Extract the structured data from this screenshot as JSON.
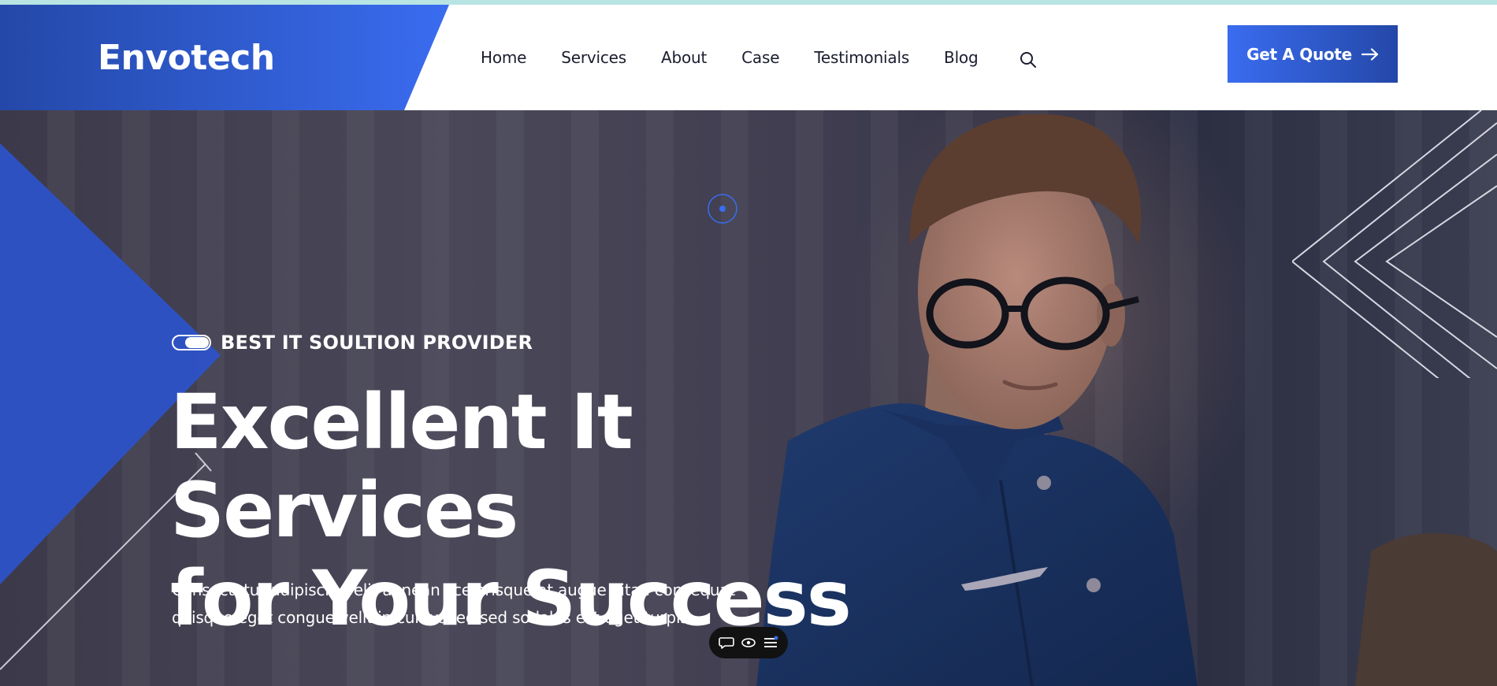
{
  "brand": {
    "name": "Envotech"
  },
  "nav": {
    "items": [
      {
        "label": "Home"
      },
      {
        "label": "Services"
      },
      {
        "label": "About"
      },
      {
        "label": "Case"
      },
      {
        "label": "Testimonials"
      },
      {
        "label": "Blog"
      }
    ],
    "search_icon": "search-icon"
  },
  "cta": {
    "label": "Get A Quote",
    "icon": "arrow-right-icon"
  },
  "hero": {
    "tagline": "BEST IT SOULTION PROVIDER",
    "title_line1": "Excellent It Services",
    "title_line2": "for Your Success",
    "desc_line1": "Consectetur adipiscing elit aenean scelerisque at augue vitae consequat",
    "desc_line2": "quisque eget congue velit in cursus leo sed sodales est eget turpis."
  },
  "toolbar": {
    "icons": [
      "comment-icon",
      "eye-icon",
      "menu-icon"
    ]
  },
  "colors": {
    "brand_blue": "#3a6cf0",
    "brand_dark_blue": "#2448a8",
    "top_strip": "#b8e4e4",
    "nav_text": "#1a1d2e"
  }
}
